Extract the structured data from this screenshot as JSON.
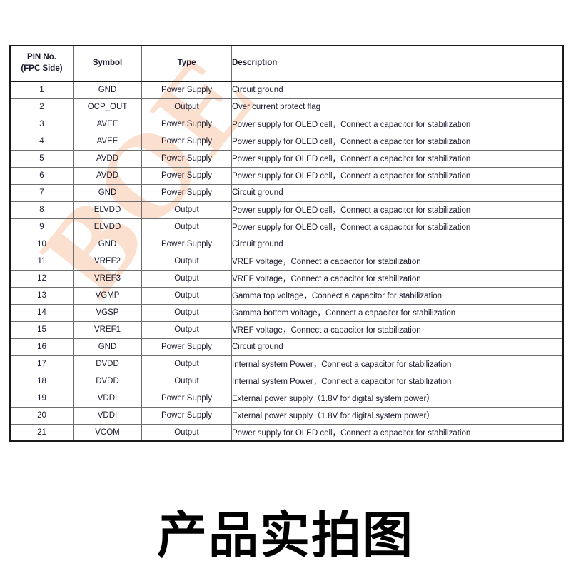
{
  "watermark": {
    "text": "BOE"
  },
  "table": {
    "columns": [
      {
        "id": "pin",
        "line1": "PIN No.",
        "line2": "(FPC Side)"
      },
      {
        "id": "symbol",
        "line1": "Symbol",
        "line2": ""
      },
      {
        "id": "type",
        "line1": "Type",
        "line2": ""
      },
      {
        "id": "desc",
        "line1": "Description",
        "line2": ""
      }
    ],
    "rows": [
      {
        "pin": "1",
        "symbol": "GND",
        "type": "Power Supply",
        "desc": "Circuit ground"
      },
      {
        "pin": "2",
        "symbol": "OCP_OUT",
        "type": "Output",
        "desc": "Over current protect flag"
      },
      {
        "pin": "3",
        "symbol": "AVEE",
        "type": "Power Supply",
        "desc": "Power supply for OLED cell，Connect a capacitor for stabilization"
      },
      {
        "pin": "4",
        "symbol": "AVEE",
        "type": "Power Supply",
        "desc": "Power supply for OLED cell，Connect a capacitor for stabilization"
      },
      {
        "pin": "5",
        "symbol": "AVDD",
        "type": "Power Supply",
        "desc": "Power supply for OLED cell，Connect a capacitor for stabilization"
      },
      {
        "pin": "6",
        "symbol": "AVDD",
        "type": "Power Supply",
        "desc": "Power supply for OLED cell，Connect a capacitor for stabilization"
      },
      {
        "pin": "7",
        "symbol": "GND",
        "type": "Power Supply",
        "desc": "Circuit ground"
      },
      {
        "pin": "8",
        "symbol": "ELVDD",
        "type": "Output",
        "desc": "Power supply for OLED cell，Connect a capacitor for stabilization"
      },
      {
        "pin": "9",
        "symbol": "ELVDD",
        "type": "Output",
        "desc": "Power supply for OLED cell，Connect a capacitor for stabilization"
      },
      {
        "pin": "10",
        "symbol": "GND",
        "type": "Power Supply",
        "desc": "Circuit ground"
      },
      {
        "pin": "11",
        "symbol": "VREF2",
        "type": "Output",
        "desc": "VREF voltage，Connect a capacitor for stabilization"
      },
      {
        "pin": "12",
        "symbol": "VREF3",
        "type": "Output",
        "desc": "VREF voltage，Connect a capacitor for stabilization"
      },
      {
        "pin": "13",
        "symbol": "VGMP",
        "type": "Output",
        "desc": "Gamma top voltage，Connect a capacitor for stabilization"
      },
      {
        "pin": "14",
        "symbol": "VGSP",
        "type": "Output",
        "desc": "Gamma bottom voltage，Connect a capacitor for stabilization"
      },
      {
        "pin": "15",
        "symbol": "VREF1",
        "type": "Output",
        "desc": "VREF voltage，Connect a capacitor for stabilization"
      },
      {
        "pin": "16",
        "symbol": "GND",
        "type": "Power Supply",
        "desc": "Circuit ground"
      },
      {
        "pin": "17",
        "symbol": "DVDD",
        "type": "Output",
        "desc": "Internal system Power，Connect a capacitor for stabilization"
      },
      {
        "pin": "18",
        "symbol": "DVDD",
        "type": "Output",
        "desc": "Internal system Power，Connect a capacitor for stabilization"
      },
      {
        "pin": "19",
        "symbol": "VDDI",
        "type": "Power Supply",
        "desc": "External power supply（1.8V for digital system power）"
      },
      {
        "pin": "20",
        "symbol": "VDDI",
        "type": "Power Supply",
        "desc": "External power supply（1.8V for digital system power）"
      },
      {
        "pin": "21",
        "symbol": "VCOM",
        "type": "Output",
        "desc": "Power supply for OLED cell，Connect a capacitor for stabilization"
      }
    ]
  },
  "caption": {
    "text": "产品实拍图"
  },
  "colors": {
    "header_bg": "#d4d2d2",
    "grid_line": "#6e6e6e",
    "outer_border": "#1a1a1a",
    "text": "#1a1a2e",
    "watermark": "#fbe0cf"
  }
}
